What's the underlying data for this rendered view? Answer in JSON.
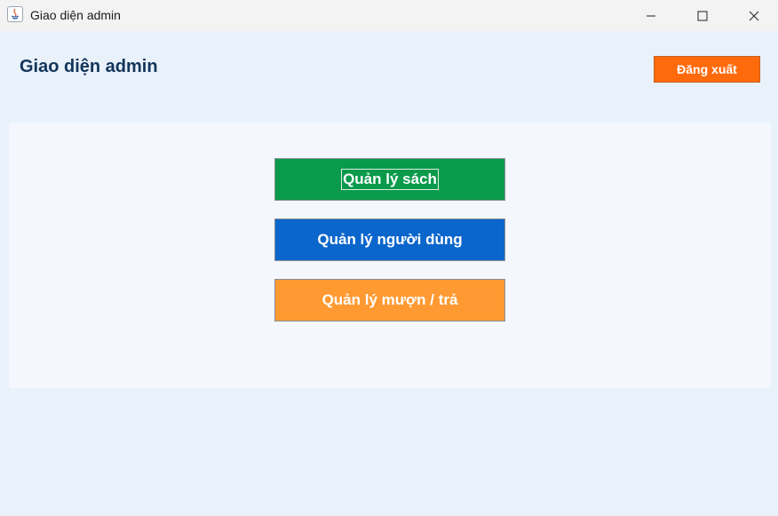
{
  "window": {
    "title": "Giao diện admin",
    "controls": [
      "minimize-icon",
      "maximize-icon",
      "close-icon"
    ]
  },
  "header": {
    "title": "Giao diện admin",
    "logout_label": "Đăng xuất"
  },
  "menu": {
    "buttons": [
      {
        "label": "Quản lý sách",
        "color": "#0a9a4b",
        "focused": true
      },
      {
        "label": "Quản lý người dùng",
        "color": "#0b66cc"
      },
      {
        "label": "Quản lý mượn / trả",
        "color": "#ff9a33"
      }
    ]
  },
  "colors": {
    "background": "#e9f1fb",
    "panel": "#f4f8fe",
    "title_text": "#12355b",
    "logout": "#ff6a0d"
  }
}
